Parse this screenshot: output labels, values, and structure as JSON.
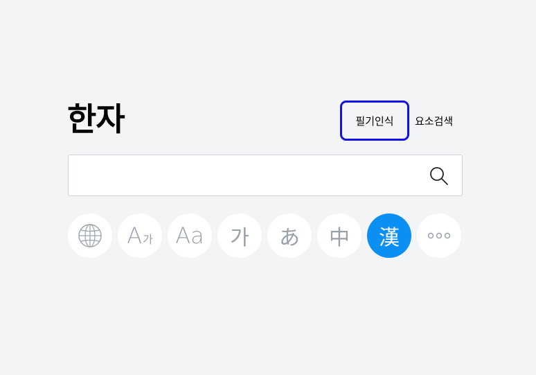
{
  "header": {
    "title": "한자",
    "handwriting_label": "필기인식",
    "element_search_label": "요소검색"
  },
  "search": {
    "value": "",
    "placeholder": ""
  },
  "dictionaries": [
    {
      "icon": "globe-icon",
      "label": ""
    },
    {
      "main": "A",
      "sub": "가"
    },
    {
      "main": "Aa",
      "sub": ""
    },
    {
      "main": "가",
      "sub": ""
    },
    {
      "main": "あ",
      "sub": ""
    },
    {
      "main": "中",
      "sub": ""
    },
    {
      "main": "漢",
      "sub": "",
      "active": true
    },
    {
      "main": "○○○",
      "sub": ""
    }
  ],
  "colors": {
    "accent": "#0a8ff5",
    "highlight_border": "#1111e8",
    "background": "#f3f4f6",
    "icon_gray": "#9aa1ab"
  }
}
